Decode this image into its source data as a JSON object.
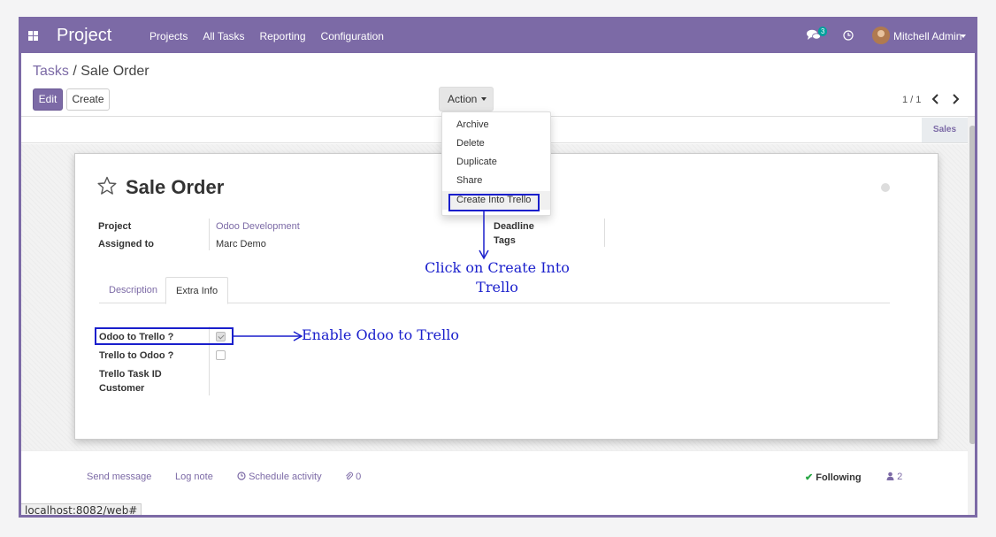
{
  "navbar": {
    "app_name": "Project",
    "menu": [
      "Projects",
      "All Tasks",
      "Reporting",
      "Configuration"
    ],
    "chat_badge": "3",
    "user_name": "Mitchell Admin"
  },
  "breadcrumb": {
    "parent": "Tasks",
    "separator": " / ",
    "current": "Sale Order"
  },
  "toolbar": {
    "edit_label": "Edit",
    "create_label": "Create",
    "action_label": "Action",
    "pager": "1 / 1"
  },
  "stage": {
    "label": "Sales"
  },
  "action_menu": {
    "items": [
      "Archive",
      "Delete",
      "Duplicate",
      "Share",
      "Create Into Trello"
    ]
  },
  "form": {
    "title": "Sale Order",
    "fields": {
      "project_label": "Project",
      "project_value": "Odoo Development",
      "assigned_label": "Assigned to",
      "assigned_value": "Marc Demo",
      "deadline_label": "Deadline",
      "tags_label": "Tags"
    },
    "tabs": [
      "Description",
      "Extra Info"
    ],
    "active_tab": "Extra Info",
    "extra_info": {
      "odoo_to_trello_label": "Odoo to Trello ?",
      "odoo_to_trello_checked": true,
      "trello_to_odoo_label": "Trello to Odoo ?",
      "trello_to_odoo_checked": false,
      "trello_task_id_label": "Trello Task ID",
      "customer_label": "Customer"
    }
  },
  "annotations": {
    "click_create_line1": "Click on Create Into",
    "click_create_line2": "Trello",
    "enable_trello": "Enable Odoo to Trello",
    "color": "#1a1fcc"
  },
  "chatter": {
    "send_message": "Send message",
    "log_note": "Log note",
    "schedule_activity": "Schedule activity",
    "attachments_count": "0",
    "following": "Following",
    "followers_count": "2"
  },
  "status_url": "localhost:8082/web#",
  "colors": {
    "brand": "#7c6aa6",
    "success": "#28a745"
  }
}
